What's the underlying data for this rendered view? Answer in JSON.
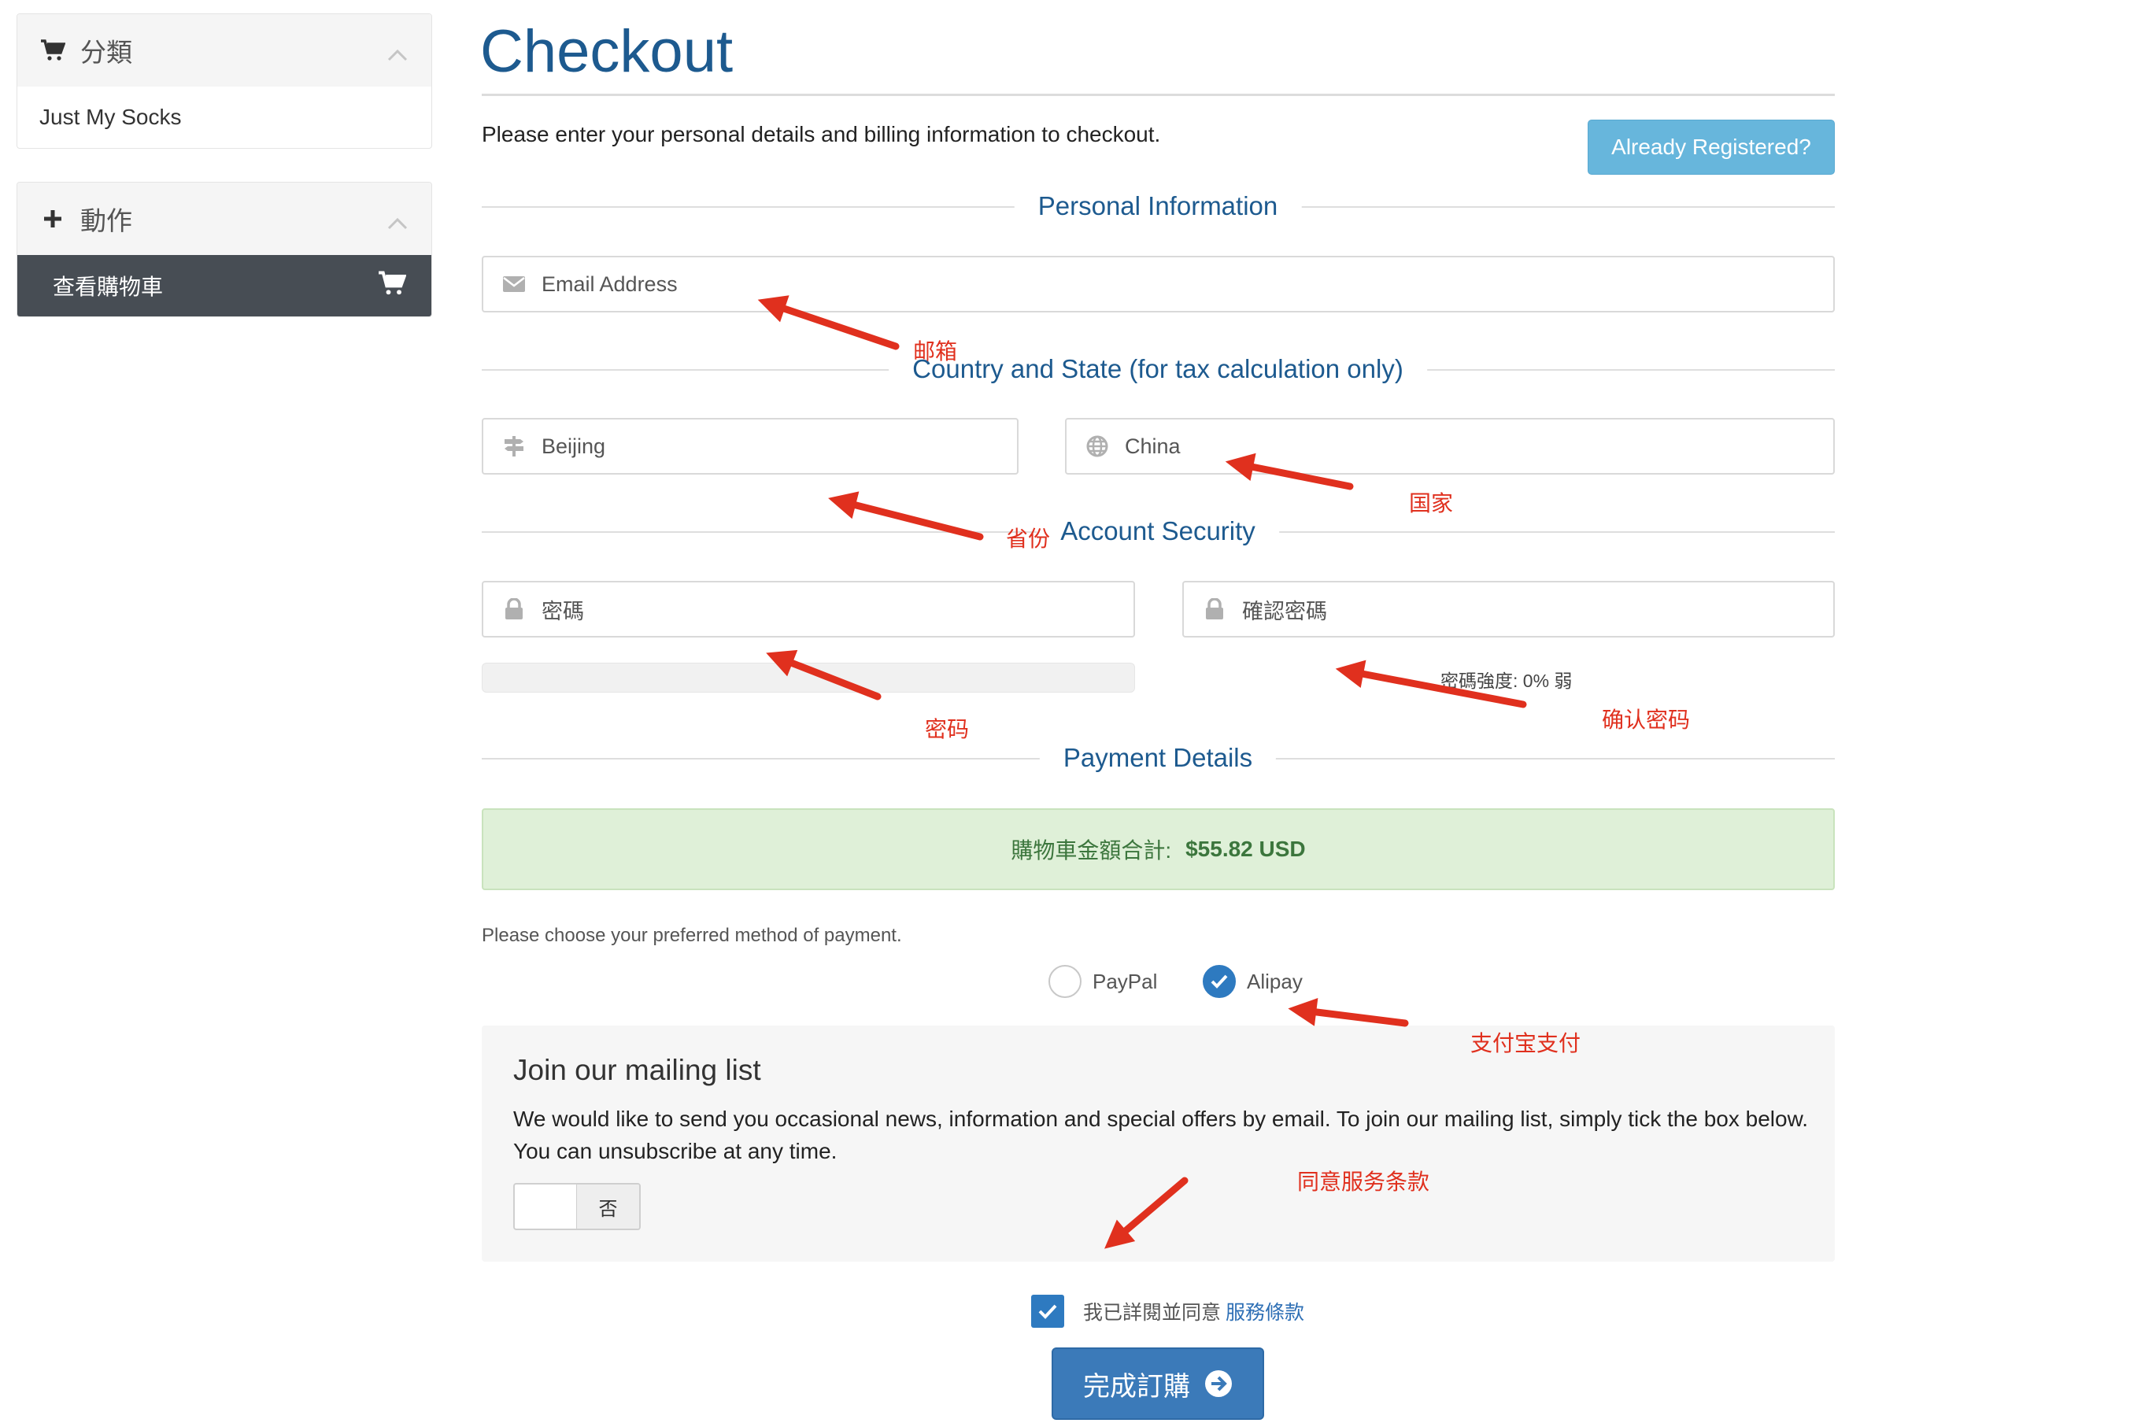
{
  "sidebar": {
    "categories": {
      "title": "分類",
      "items": [
        "Just My Socks"
      ]
    },
    "actions": {
      "title": "動作",
      "active_item": "查看購物車"
    }
  },
  "main": {
    "title": "Checkout",
    "intro": "Please enter your personal details and billing information to checkout.",
    "already_registered": "Already Registered?",
    "sections": {
      "personal": "Personal Information",
      "country": "Country and State (for tax calculation only)",
      "security": "Account Security",
      "payment": "Payment Details"
    },
    "fields": {
      "email_placeholder": "Email Address",
      "state_value": "Beijing",
      "country_value": "China",
      "password_placeholder": "密碼",
      "confirm_placeholder": "確認密碼"
    },
    "password_strength": "密碼強度: 0% 弱",
    "payment": {
      "total_label": "購物車金額合計:",
      "total_value": "$55.82 USD",
      "hint": "Please choose your preferred method of payment.",
      "methods": [
        "PayPal",
        "Alipay"
      ],
      "selected": "Alipay"
    },
    "mailing": {
      "title": "Join our mailing list",
      "text": "We would like to send you occasional news, information and special offers by email. To join our mailing list, simply tick the box below. You can unsubscribe at any time.",
      "toggle_off_label": "否"
    },
    "tos": {
      "text": "我已詳閱並同意",
      "link": "服務條款"
    },
    "complete_button": "完成訂購"
  },
  "annotations": {
    "email": "邮箱",
    "country": "国家",
    "province": "省份",
    "password": "密码",
    "confirm_password": "确认密码",
    "alipay": "支付宝支付",
    "agree_terms": "同意服务条款"
  },
  "colors": {
    "brand_blue": "#1d5a8f",
    "button_blue": "#3b7ab9",
    "info_button": "#67b6dc",
    "success_bg": "#dff0d8",
    "annotation_red": "#e0301e",
    "sidebar_active": "#474d54"
  }
}
